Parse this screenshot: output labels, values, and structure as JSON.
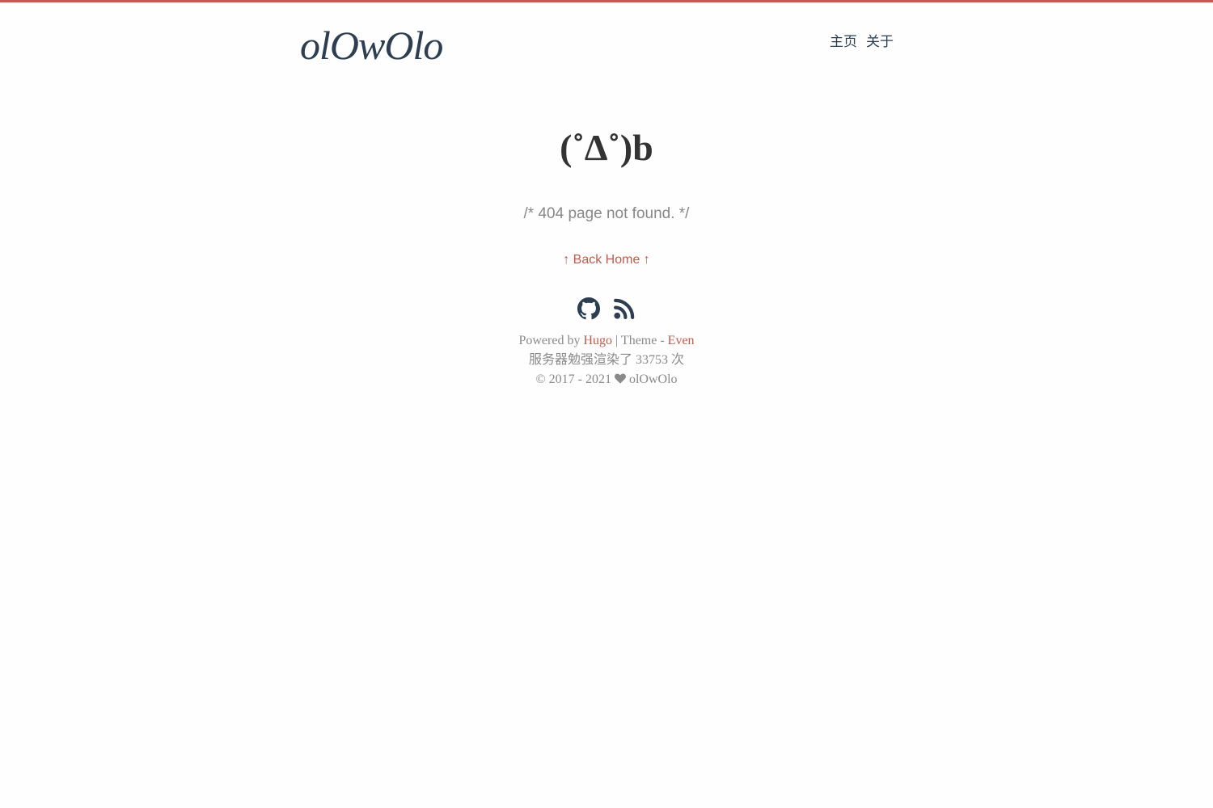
{
  "header": {
    "logo": "olOwOlo",
    "nav": [
      {
        "label": "主页"
      },
      {
        "label": "关于"
      }
    ]
  },
  "main": {
    "kaomoji": "(˚Δ˚)b",
    "message": "/* 404 page not found. */",
    "back_home": "↑ Back Home ↑"
  },
  "footer": {
    "social": [
      {
        "icon": "github-icon"
      },
      {
        "icon": "rss-icon"
      }
    ],
    "powered_by": "Powered by",
    "hugo": "Hugo",
    "theme_sep": "| Theme -",
    "even": "Even",
    "busuanzi": "服务器勉强渲染了 33753 次",
    "copyright_years": "© 2017 - 2021",
    "author": "olOwOlo"
  },
  "colors": {
    "accent": "#c05b4d",
    "logo": "#2c3e50",
    "text_muted": "#8a8a8a",
    "background": "#fefefe"
  }
}
